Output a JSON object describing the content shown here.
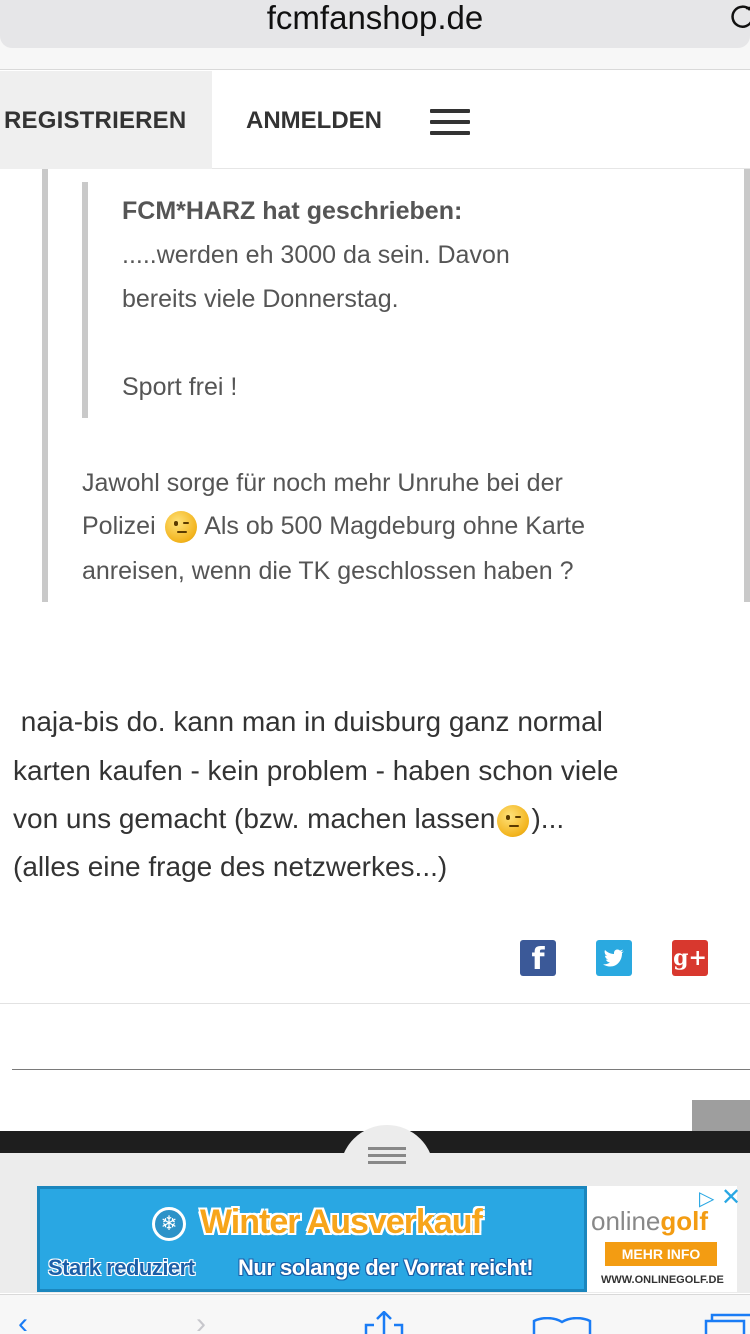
{
  "browser": {
    "url": "fcmfanshop.de"
  },
  "nav": {
    "register_label": "REGISTRIEREN",
    "login_label": "ANMELDEN"
  },
  "quote": {
    "author": "FCM*HARZ hat geschrieben:",
    "lines": [
      ".....werden eh 3000 da sein. Davon",
      "bereits viele Donnerstag.",
      "Sport frei !"
    ],
    "reply_lines": [
      "Jawohl sorge für noch mehr Unruhe bei der",
      "Polizei",
      "Als ob 500 Magdeburg ohne Karte",
      "anreisen, wenn die TK geschlossen haben ?"
    ]
  },
  "post": {
    "lines": [
      " naja-bis do. kann man in duisburg ganz normal",
      "karten kaufen - kein problem - haben schon viele",
      "von uns gemacht (bzw. machen lassen",
      ")...",
      "(alles eine frage des netzwerkes...)"
    ]
  },
  "social": {
    "facebook": "f",
    "twitter": "t",
    "googleplus": "g+"
  },
  "ad": {
    "title": "Winter Ausverkauf",
    "sub1": "Stark reduziert",
    "sub2": "Nur solange der Vorrat reicht!",
    "brand_a": "online",
    "brand_b": "golf",
    "cta": "MEHR INFO",
    "url": "WWW.ONLINEGOLF.DE"
  },
  "colors": {
    "ad_blue": "#29a7e3",
    "ad_orange": "#f39c12",
    "ios_blue": "#1a7cf5"
  }
}
